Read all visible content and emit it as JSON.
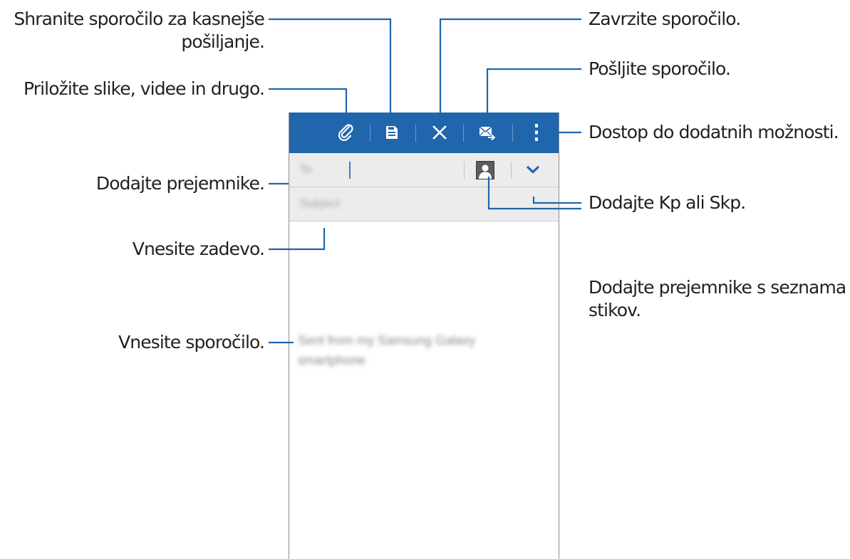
{
  "callouts": {
    "save_line1": "Shranite sporočilo za kasnejše",
    "save_line2": "pošiljanje.",
    "attach": "Priložite slike, videe in drugo.",
    "discard": "Zavrzite sporočilo.",
    "send": "Pošljite sporočilo.",
    "more": "Dostop do dodatnih možnosti.",
    "recipients": "Dodajte prejemnike.",
    "cc_bcc": "Dodajte Kp ali Skp.",
    "subject": "Vnesite zadevo.",
    "contacts_line1": "Dodajte prejemnike s seznama",
    "contacts_line2": "stikov.",
    "message": "Vnesite sporočilo."
  },
  "compose": {
    "to_placeholder": "To",
    "subject_placeholder": "Subject",
    "body_line1": "Sent from my Samsung Galaxy",
    "body_line2": "smartphone"
  },
  "icons": {
    "attach": "paperclip-icon",
    "save": "save-draft-icon",
    "discard": "close-icon",
    "send": "send-mail-icon",
    "more": "more-options-icon",
    "contacts": "contact-icon",
    "expand": "chevron-down-icon"
  },
  "colors": {
    "actionbar": "#1f66ad",
    "field_background": "#ececec",
    "cursor": "#3b7fc4",
    "leader_lines": "#1f66ad"
  }
}
